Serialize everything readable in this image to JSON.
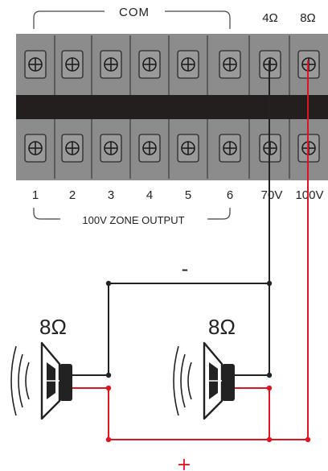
{
  "colors": {
    "panel": "#8c8c8c",
    "panel_dark": "#6b6b6b",
    "bar": "#231f1f",
    "line": "#222222",
    "positive": "#e0141e",
    "negative": "#222222",
    "text": "#222222"
  },
  "terminal_block": {
    "com_label": "COM",
    "tap_labels": [
      "4Ω",
      "8Ω"
    ],
    "zone_numbers": [
      "1",
      "2",
      "3",
      "4",
      "5",
      "6"
    ],
    "line_labels": [
      "70V",
      "100V"
    ],
    "bottom_caption": "100V ZONE OUTPUT"
  },
  "wiring": {
    "negative_sign": "-",
    "positive_sign": "+"
  },
  "speakers": [
    {
      "impedance": "8Ω",
      "icon": "speaker-icon"
    },
    {
      "impedance": "8Ω",
      "icon": "speaker-icon"
    }
  ]
}
